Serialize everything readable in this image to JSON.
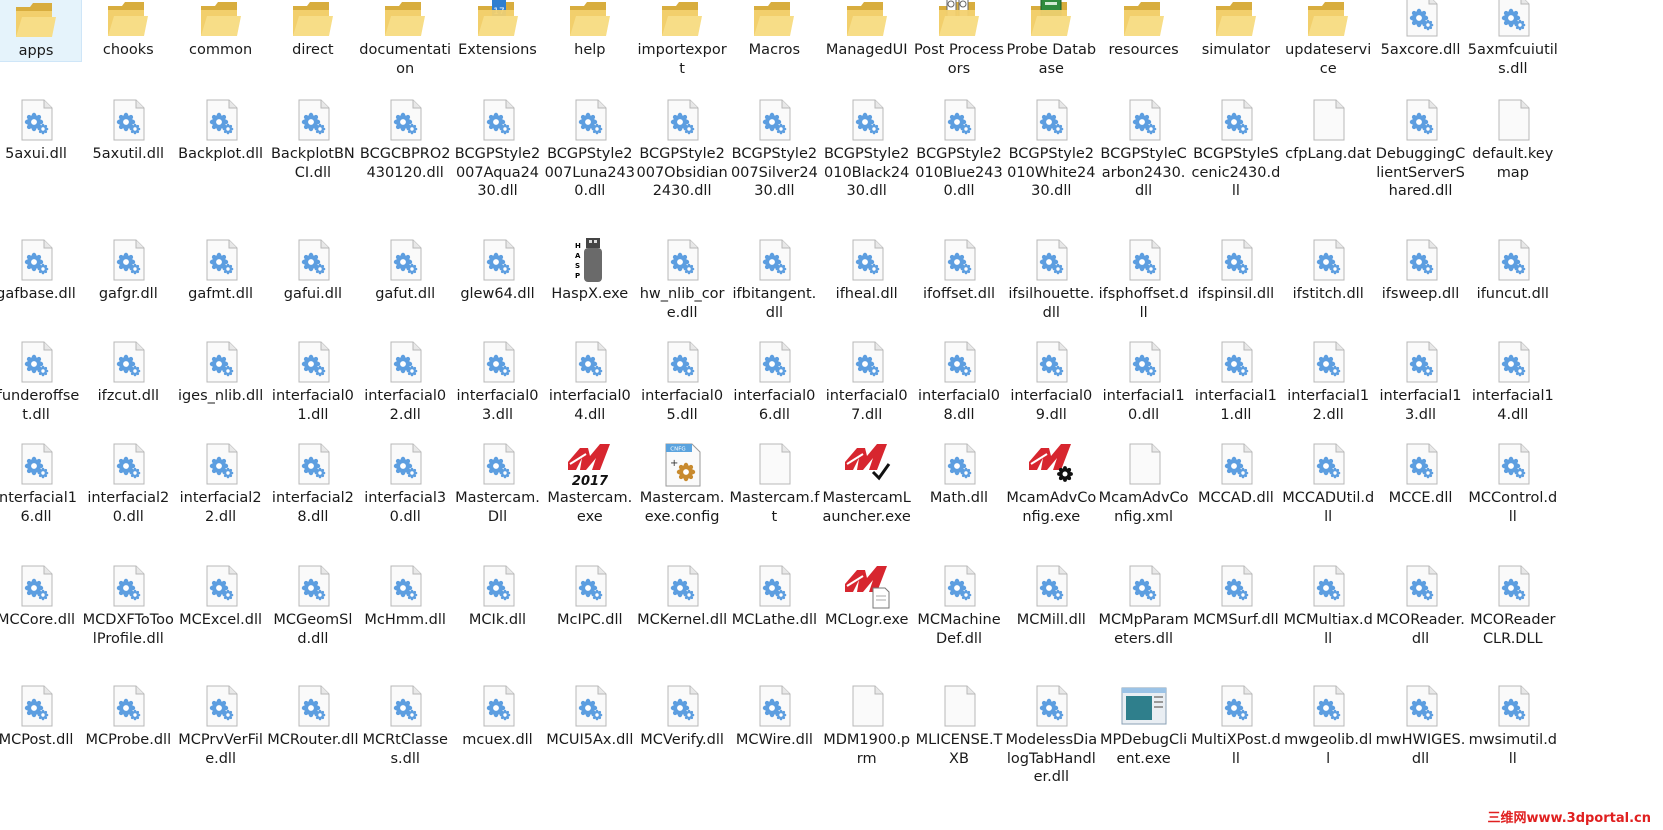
{
  "colors": {
    "folder": "#f3d16f",
    "folder_dark": "#d8ad3e",
    "gear": "#5d9ee0",
    "mastercam_red": "#d7262f",
    "hasp_gray": "#6a6a6a"
  },
  "watermark": "三维网www.3dportal.cn",
  "rows": [
    [
      {
        "label": "apps",
        "icon": "folder",
        "selected": true
      },
      {
        "label": "chooks",
        "icon": "folder"
      },
      {
        "label": "common",
        "icon": "folder"
      },
      {
        "label": "direct",
        "icon": "folder"
      },
      {
        "label": "documentation",
        "icon": "folder"
      },
      {
        "label": "Extensions",
        "icon": "folder-app"
      },
      {
        "label": "help",
        "icon": "folder"
      },
      {
        "label": "importexport",
        "icon": "folder"
      },
      {
        "label": "Macros",
        "icon": "folder"
      },
      {
        "label": "ManagedUI",
        "icon": "folder"
      },
      {
        "label": "Post Processors",
        "icon": "folder-post"
      },
      {
        "label": "Probe Database",
        "icon": "folder-book"
      },
      {
        "label": "resources",
        "icon": "folder"
      },
      {
        "label": "simulator",
        "icon": "folder"
      },
      {
        "label": "updateservice",
        "icon": "folder"
      },
      {
        "label": "5axcore.dll",
        "icon": "dll"
      },
      {
        "label": "5axmfcuiutils.dll",
        "icon": "dll"
      }
    ],
    [
      {
        "label": "5axui.dll",
        "icon": "dll"
      },
      {
        "label": "5axutil.dll",
        "icon": "dll"
      },
      {
        "label": "Backplot.dll",
        "icon": "dll"
      },
      {
        "label": "BackplotBNCI.dll",
        "icon": "dll"
      },
      {
        "label": "BCGCBPRO2430120.dll",
        "icon": "dll"
      },
      {
        "label": "BCGPStyle2007Aqua2430.dll",
        "icon": "dll"
      },
      {
        "label": "BCGPStyle2007Luna2430.dll",
        "icon": "dll"
      },
      {
        "label": "BCGPStyle2007Obsidian2430.dll",
        "icon": "dll"
      },
      {
        "label": "BCGPStyle2007Silver2430.dll",
        "icon": "dll"
      },
      {
        "label": "BCGPStyle2010Black2430.dll",
        "icon": "dll"
      },
      {
        "label": "BCGPStyle2010Blue2430.dll",
        "icon": "dll"
      },
      {
        "label": "BCGPStyle2010White2430.dll",
        "icon": "dll"
      },
      {
        "label": "BCGPStyleCarbon2430.dll",
        "icon": "dll"
      },
      {
        "label": "BCGPStyleScenic2430.dll",
        "icon": "dll"
      },
      {
        "label": "cfpLang.dat",
        "icon": "blank"
      },
      {
        "label": "DebuggingClientServerShared.dll",
        "icon": "dll"
      },
      {
        "label": "default.keymap",
        "icon": "blank"
      }
    ],
    [
      {
        "label": "gafbase.dll",
        "icon": "dll"
      },
      {
        "label": "gafgr.dll",
        "icon": "dll"
      },
      {
        "label": "gafmt.dll",
        "icon": "dll"
      },
      {
        "label": "gafui.dll",
        "icon": "dll"
      },
      {
        "label": "gafut.dll",
        "icon": "dll"
      },
      {
        "label": "glew64.dll",
        "icon": "dll"
      },
      {
        "label": "HaspX.exe",
        "icon": "hasp"
      },
      {
        "label": "hw_nlib_core.dll",
        "icon": "dll"
      },
      {
        "label": "ifbitangent.dll",
        "icon": "dll"
      },
      {
        "label": "ifheal.dll",
        "icon": "dll"
      },
      {
        "label": "ifoffset.dll",
        "icon": "dll"
      },
      {
        "label": "ifsilhouette.dll",
        "icon": "dll"
      },
      {
        "label": "ifsphoffset.dll",
        "icon": "dll"
      },
      {
        "label": "ifspinsil.dll",
        "icon": "dll"
      },
      {
        "label": "ifstitch.dll",
        "icon": "dll"
      },
      {
        "label": "ifsweep.dll",
        "icon": "dll"
      },
      {
        "label": "ifuncut.dll",
        "icon": "dll"
      }
    ],
    [
      {
        "label": "ifunderoffset.dll",
        "icon": "dll"
      },
      {
        "label": "ifzcut.dll",
        "icon": "dll"
      },
      {
        "label": "iges_nlib.dll",
        "icon": "dll"
      },
      {
        "label": "interfacial01.dll",
        "icon": "dll"
      },
      {
        "label": "interfacial02.dll",
        "icon": "dll"
      },
      {
        "label": "interfacial03.dll",
        "icon": "dll"
      },
      {
        "label": "interfacial04.dll",
        "icon": "dll"
      },
      {
        "label": "interfacial05.dll",
        "icon": "dll"
      },
      {
        "label": "interfacial06.dll",
        "icon": "dll"
      },
      {
        "label": "interfacial07.dll",
        "icon": "dll"
      },
      {
        "label": "interfacial08.dll",
        "icon": "dll"
      },
      {
        "label": "interfacial09.dll",
        "icon": "dll"
      },
      {
        "label": "interfacial10.dll",
        "icon": "dll"
      },
      {
        "label": "interfacial11.dll",
        "icon": "dll"
      },
      {
        "label": "interfacial12.dll",
        "icon": "dll"
      },
      {
        "label": "interfacial13.dll",
        "icon": "dll"
      },
      {
        "label": "interfacial14.dll",
        "icon": "dll"
      }
    ],
    [
      {
        "label": "interfacial16.dll",
        "icon": "dll"
      },
      {
        "label": "interfacial20.dll",
        "icon": "dll"
      },
      {
        "label": "interfacial22.dll",
        "icon": "dll"
      },
      {
        "label": "interfacial28.dll",
        "icon": "dll"
      },
      {
        "label": "interfacial30.dll",
        "icon": "dll"
      },
      {
        "label": "Mastercam.Dll",
        "icon": "dll"
      },
      {
        "label": "Mastercam.exe",
        "icon": "mastercam-2017",
        "badge": "2017"
      },
      {
        "label": "Mastercam.exe.config",
        "icon": "config",
        "badge": "CNFG"
      },
      {
        "label": "Mastercam.ft",
        "icon": "blank"
      },
      {
        "label": "MastercamLauncher.exe",
        "icon": "mastercam-check"
      },
      {
        "label": "Math.dll",
        "icon": "dll"
      },
      {
        "label": "McamAdvConfig.exe",
        "icon": "mastercam-gear"
      },
      {
        "label": "McamAdvConfig.xml",
        "icon": "blank"
      },
      {
        "label": "MCCAD.dll",
        "icon": "dll"
      },
      {
        "label": "MCCADUtil.dll",
        "icon": "dll"
      },
      {
        "label": "MCCE.dll",
        "icon": "dll"
      },
      {
        "label": "MCControl.dll",
        "icon": "dll"
      }
    ],
    [
      {
        "label": "MCCore.dll",
        "icon": "dll"
      },
      {
        "label": "MCDXFToToolProfile.dll",
        "icon": "dll"
      },
      {
        "label": "MCExcel.dll",
        "icon": "dll"
      },
      {
        "label": "MCGeomSld.dll",
        "icon": "dll"
      },
      {
        "label": "McHmm.dll",
        "icon": "dll"
      },
      {
        "label": "MCIk.dll",
        "icon": "dll"
      },
      {
        "label": "McIPC.dll",
        "icon": "dll"
      },
      {
        "label": "MCKernel.dll",
        "icon": "dll"
      },
      {
        "label": "MCLathe.dll",
        "icon": "dll"
      },
      {
        "label": "MCLogr.exe",
        "icon": "mastercam-doc"
      },
      {
        "label": "MCMachineDef.dll",
        "icon": "dll"
      },
      {
        "label": "MCMill.dll",
        "icon": "dll"
      },
      {
        "label": "MCMpParameters.dll",
        "icon": "dll"
      },
      {
        "label": "MCMSurf.dll",
        "icon": "dll"
      },
      {
        "label": "MCMultiax.dll",
        "icon": "dll"
      },
      {
        "label": "MCOReader.dll",
        "icon": "dll"
      },
      {
        "label": "MCOReaderCLR.DLL",
        "icon": "dll"
      }
    ],
    [
      {
        "label": "MCPost.dll",
        "icon": "dll"
      },
      {
        "label": "MCProbe.dll",
        "icon": "dll"
      },
      {
        "label": "MCPrvVerFile.dll",
        "icon": "dll"
      },
      {
        "label": "MCRouter.dll",
        "icon": "dll"
      },
      {
        "label": "MCRtClasses.dll",
        "icon": "dll"
      },
      {
        "label": "mcuex.dll",
        "icon": "dll"
      },
      {
        "label": "MCUI5Ax.dll",
        "icon": "dll"
      },
      {
        "label": "MCVerify.dll",
        "icon": "dll"
      },
      {
        "label": "MCWire.dll",
        "icon": "dll"
      },
      {
        "label": "MDM1900.prm",
        "icon": "blank"
      },
      {
        "label": "MLICENSE.TXB",
        "icon": "blank"
      },
      {
        "label": "ModelessDialogTabHandler.dll",
        "icon": "dll"
      },
      {
        "label": "MPDebugClient.exe",
        "icon": "window"
      },
      {
        "label": "MultiXPost.dll",
        "icon": "dll"
      },
      {
        "label": "mwgeolib.dll",
        "icon": "dll"
      },
      {
        "label": "mwHWIGES.dll",
        "icon": "dll"
      },
      {
        "label": "mwsimutil.dll",
        "icon": "dll"
      }
    ]
  ]
}
